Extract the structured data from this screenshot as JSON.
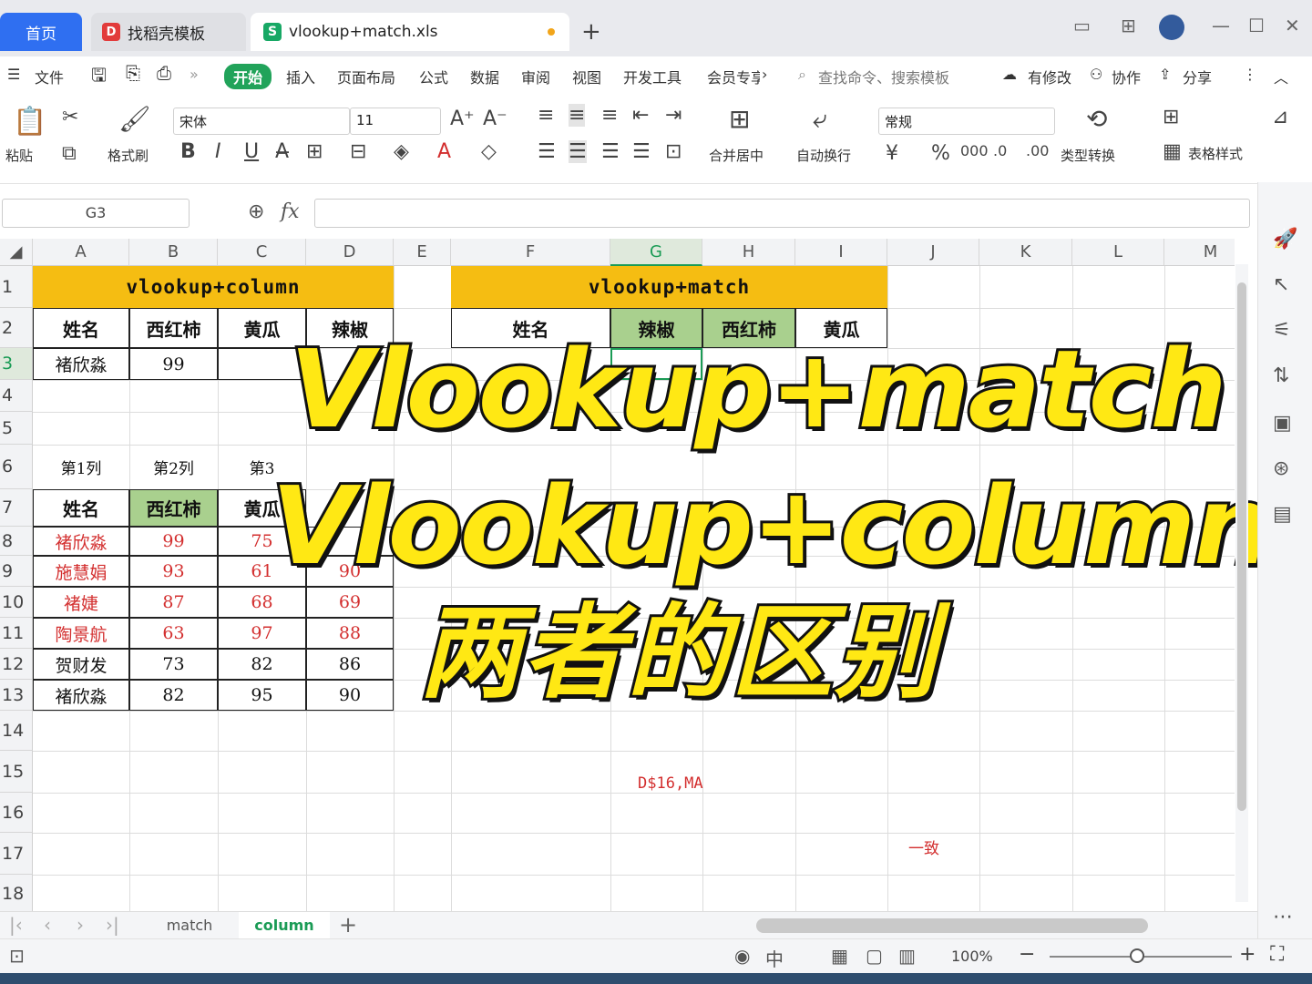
{
  "window": {
    "tabs": [
      {
        "label": "首页"
      },
      {
        "label": "找稻壳模板"
      },
      {
        "label": "vlookup+match.xls"
      }
    ]
  },
  "menu": {
    "file": "文件",
    "items": [
      "开始",
      "插入",
      "页面布局",
      "公式",
      "数据",
      "审阅",
      "视图",
      "开发工具",
      "会员专享"
    ],
    "search_placeholder": "查找命令、搜索模板",
    "modified": "有修改",
    "collab": "协作",
    "share": "分享"
  },
  "ribbon": {
    "paste": "粘贴",
    "format_painter": "格式刷",
    "font_name": "宋体",
    "font_size": "11",
    "merge_center": "合并居中",
    "wrap": "自动换行",
    "number_format": "常规",
    "type_convert": "类型转换",
    "table_style": "表格样式"
  },
  "formula_bar": {
    "name_box": "G3",
    "fx": "fx"
  },
  "columns": [
    "A",
    "B",
    "C",
    "D",
    "E",
    "F",
    "G",
    "H",
    "I",
    "J",
    "K",
    "L",
    "M"
  ],
  "rows": [
    "1",
    "2",
    "3",
    "4",
    "5",
    "6",
    "7",
    "8",
    "9",
    "10",
    "11",
    "12",
    "13",
    "14",
    "15",
    "16",
    "17",
    "18"
  ],
  "table1": {
    "title": "vlookup+column",
    "headers": [
      "姓名",
      "西红柿",
      "黄瓜",
      "辣椒"
    ],
    "row3": [
      "褚欣淼",
      "99"
    ],
    "col_labels": [
      "第1列",
      "第2列",
      "第3"
    ],
    "headers7": [
      "姓名",
      "西红柿",
      "黄瓜"
    ],
    "data": [
      [
        "褚欣淼",
        "99",
        "75",
        ""
      ],
      [
        "施慧娟",
        "93",
        "61",
        "90"
      ],
      [
        "褚婕",
        "87",
        "68",
        "69"
      ],
      [
        "陶景航",
        "63",
        "97",
        "88"
      ],
      [
        "贺财发",
        "73",
        "82",
        "86"
      ],
      [
        "褚欣淼",
        "82",
        "95",
        "90"
      ]
    ]
  },
  "table2": {
    "title": "vlookup+match",
    "headers": [
      "姓名",
      "辣椒",
      "西红柿",
      "黄瓜"
    ]
  },
  "fragments": {
    "formula_hint": "D$16,MA",
    "note": "一致"
  },
  "overlay": {
    "line1": "Vlookup+match",
    "line2": "Vlookup+column",
    "line3": "两者的区别"
  },
  "sheets": {
    "tabs": [
      "match",
      "column"
    ],
    "active": "column"
  },
  "status": {
    "zoom": "100%"
  },
  "colors": {
    "accent_blue": "#2f6ff1",
    "accent_green": "#21a35a",
    "title_yellow": "#f5bd12",
    "header_green": "#a9d08e",
    "overlay_yellow": "#ffe814"
  }
}
